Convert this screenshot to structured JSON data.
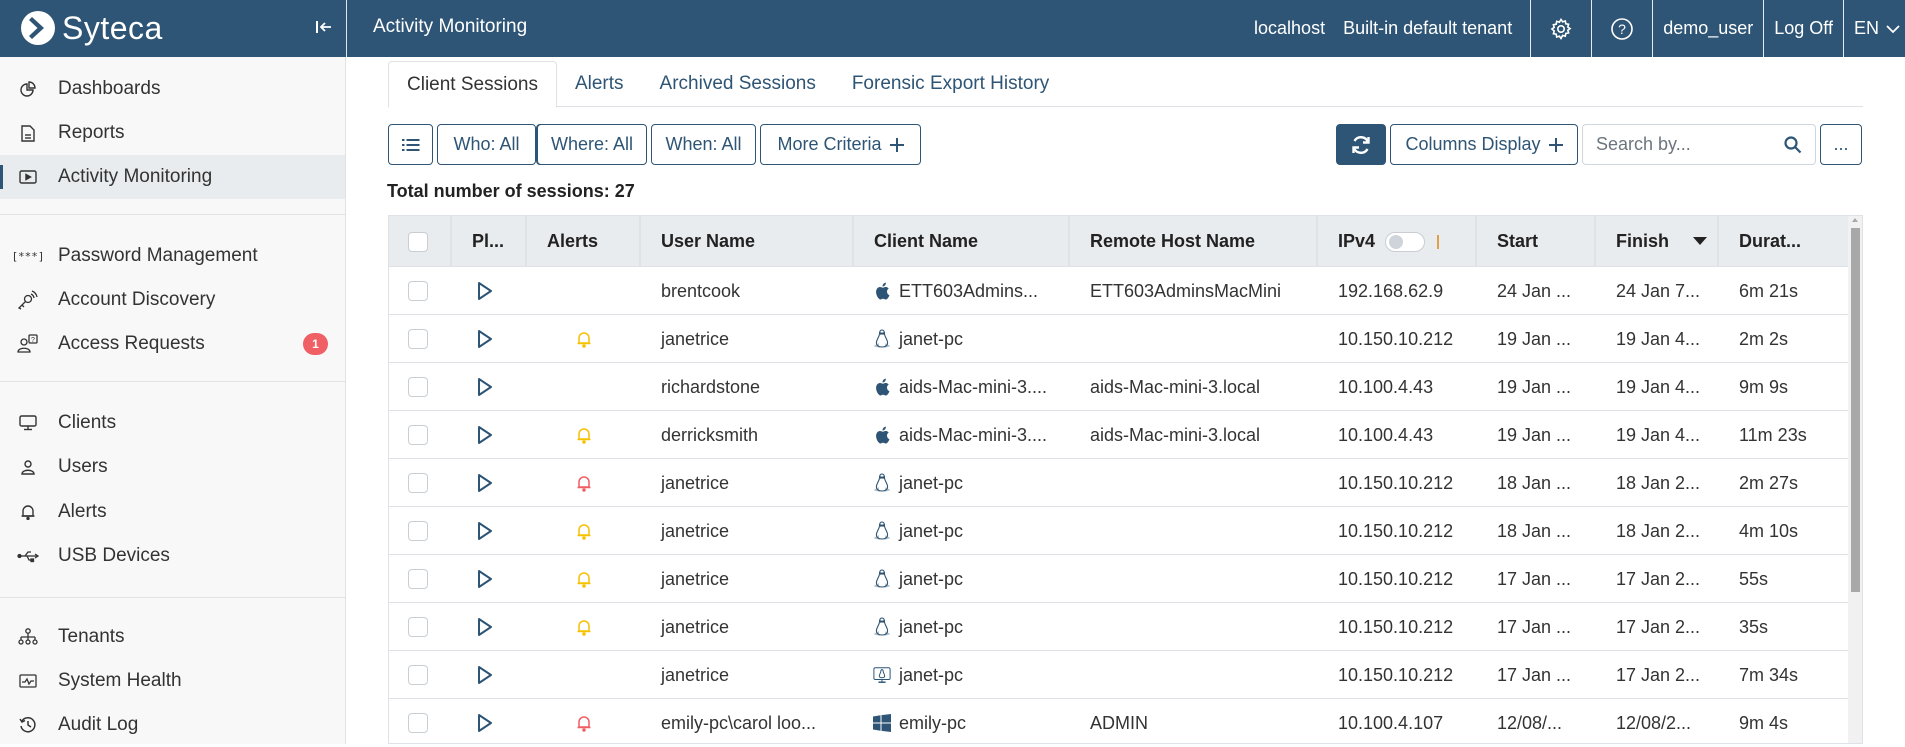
{
  "app": {
    "brand": "Syteca",
    "page_title": "Activity Monitoring"
  },
  "topbar": {
    "server": "localhost",
    "tenant": "Built-in default tenant",
    "settings_icon": "gear-icon",
    "help_icon": "question-circle-icon",
    "user": "demo_user",
    "logoff": "Log Off",
    "language": "EN"
  },
  "sidebar": {
    "groups": [
      [
        {
          "label": "Dashboards",
          "icon": "pie-chart-icon",
          "active": false
        },
        {
          "label": "Reports",
          "icon": "document-icon",
          "active": false
        },
        {
          "label": "Activity Monitoring",
          "icon": "play-screen-icon",
          "active": true
        }
      ],
      [
        {
          "label": "Password Management",
          "icon": "password-icon",
          "active": false
        },
        {
          "label": "Account Discovery",
          "icon": "key-signal-icon",
          "active": false
        },
        {
          "label": "Access Requests",
          "icon": "user-question-icon",
          "active": false,
          "badge": "1"
        }
      ],
      [
        {
          "label": "Clients",
          "icon": "monitor-icon",
          "active": false
        },
        {
          "label": "Users",
          "icon": "user-icon",
          "active": false
        },
        {
          "label": "Alerts",
          "icon": "bell-icon",
          "active": false
        },
        {
          "label": "USB Devices",
          "icon": "usb-icon",
          "active": false
        }
      ],
      [
        {
          "label": "Tenants",
          "icon": "hierarchy-icon",
          "active": false
        },
        {
          "label": "System Health",
          "icon": "pulse-icon",
          "active": false
        },
        {
          "label": "Audit Log",
          "icon": "history-icon",
          "active": false
        }
      ]
    ]
  },
  "tabs": [
    {
      "label": "Client Sessions",
      "active": true
    },
    {
      "label": "Alerts",
      "active": false
    },
    {
      "label": "Archived Sessions",
      "active": false
    },
    {
      "label": "Forensic Export History",
      "active": false
    }
  ],
  "filters": {
    "who": "Who: All",
    "where": "Where: All",
    "when": "When: All",
    "more": "More Criteria",
    "columns_display": "Columns Display",
    "search_placeholder": "Search by...",
    "more_options": "..."
  },
  "summary": {
    "total_label": "Total number of sessions: 27"
  },
  "table": {
    "columns": [
      "",
      "Pl...",
      "Alerts",
      "User Name",
      "Client Name",
      "Remote Host Name",
      "IPv4",
      "Start",
      "Finish",
      "Durat..."
    ],
    "sort": {
      "column": "Finish",
      "direction": "desc"
    },
    "ipv4_toggle": false,
    "rows": [
      {
        "alert": "",
        "user": "brentcook",
        "os": "apple",
        "client": "ETT603Admins...",
        "remote": "ETT603AdminsMacMini",
        "ipv4": "192.168.62.9",
        "start": "24 Jan ...",
        "finish": "24 Jan 7...",
        "duration": "6m 21s"
      },
      {
        "alert": "warning",
        "user": "janetrice",
        "os": "linux",
        "client": "janet-pc",
        "remote": "",
        "ipv4": "10.150.10.212",
        "start": "19 Jan ...",
        "finish": "19 Jan 4...",
        "duration": "2m 2s"
      },
      {
        "alert": "",
        "user": "richardstone",
        "os": "apple",
        "client": "aids-Mac-mini-3....",
        "remote": "aids-Mac-mini-3.local",
        "ipv4": "10.100.4.43",
        "start": "19 Jan ...",
        "finish": "19 Jan 4...",
        "duration": "9m 9s"
      },
      {
        "alert": "warning",
        "user": "derricksmith",
        "os": "apple",
        "client": "aids-Mac-mini-3....",
        "remote": "aids-Mac-mini-3.local",
        "ipv4": "10.100.4.43",
        "start": "19 Jan ...",
        "finish": "19 Jan 4...",
        "duration": "11m 23s"
      },
      {
        "alert": "critical",
        "user": "janetrice",
        "os": "linux",
        "client": "janet-pc",
        "remote": "",
        "ipv4": "10.150.10.212",
        "start": "18 Jan ...",
        "finish": "18 Jan 2...",
        "duration": "2m 27s"
      },
      {
        "alert": "warning",
        "user": "janetrice",
        "os": "linux",
        "client": "janet-pc",
        "remote": "",
        "ipv4": "10.150.10.212",
        "start": "18 Jan ...",
        "finish": "18 Jan 2...",
        "duration": "4m 10s"
      },
      {
        "alert": "warning",
        "user": "janetrice",
        "os": "linux",
        "client": "janet-pc",
        "remote": "",
        "ipv4": "10.150.10.212",
        "start": "17 Jan ...",
        "finish": "17 Jan 2...",
        "duration": "55s"
      },
      {
        "alert": "warning",
        "user": "janetrice",
        "os": "linux",
        "client": "janet-pc",
        "remote": "",
        "ipv4": "10.150.10.212",
        "start": "17 Jan ...",
        "finish": "17 Jan 2...",
        "duration": "35s"
      },
      {
        "alert": "",
        "user": "janetrice",
        "os": "linux-remote",
        "client": "janet-pc",
        "remote": "",
        "ipv4": "10.150.10.212",
        "start": "17 Jan ...",
        "finish": "17 Jan 2...",
        "duration": "7m 34s"
      },
      {
        "alert": "critical",
        "user": "emily-pc\\carol loo...",
        "os": "windows",
        "client": "emily-pc",
        "remote": "ADMIN",
        "ipv4": "10.100.4.107",
        "start": "12/08/...",
        "finish": "12/08/2...",
        "duration": "9m 4s"
      }
    ]
  },
  "colors": {
    "brand": "#2e5575",
    "alert_warning": "#f5c000",
    "alert_critical": "#ef5f63",
    "badge": "#ef5f63"
  }
}
